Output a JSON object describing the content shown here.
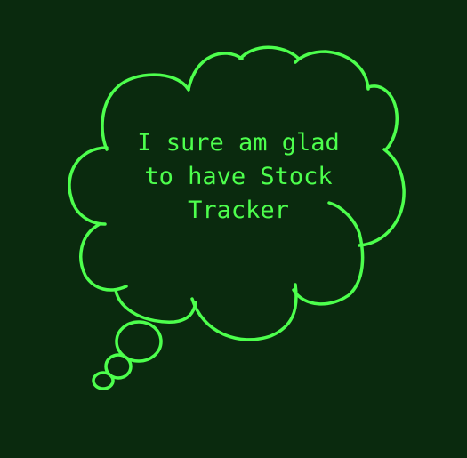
{
  "colors": {
    "background": "#0a2a0e",
    "stroke": "#4dff4d",
    "text": "#4dff4d"
  },
  "thought": {
    "lines": [
      "I sure am glad",
      "to have Stock",
      "Tracker"
    ]
  }
}
